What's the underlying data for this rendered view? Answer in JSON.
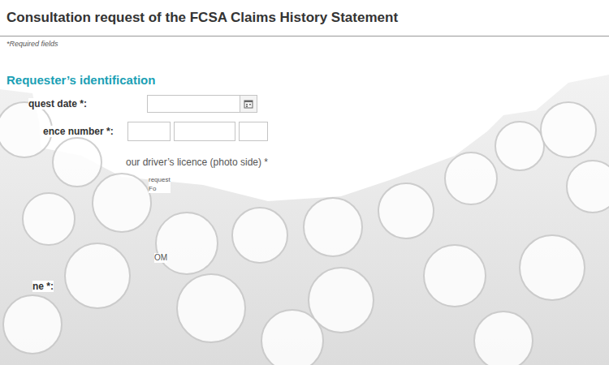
{
  "page": {
    "title": "Consultation request of the FCSA Claims History Statement",
    "required_note": "*Required fields"
  },
  "section": {
    "title": "Requester’s identification"
  },
  "date_field": {
    "label": "quest date *:",
    "value": ""
  },
  "licence_field": {
    "label": "ence number *:",
    "parts": [
      "",
      "",
      ""
    ]
  },
  "upload": {
    "label": "our driver’s licence (photo side) *"
  },
  "fragments": [
    "request",
    "Fo"
  ],
  "fragment_low": "OM",
  "last_field": {
    "label": "ne *:"
  }
}
